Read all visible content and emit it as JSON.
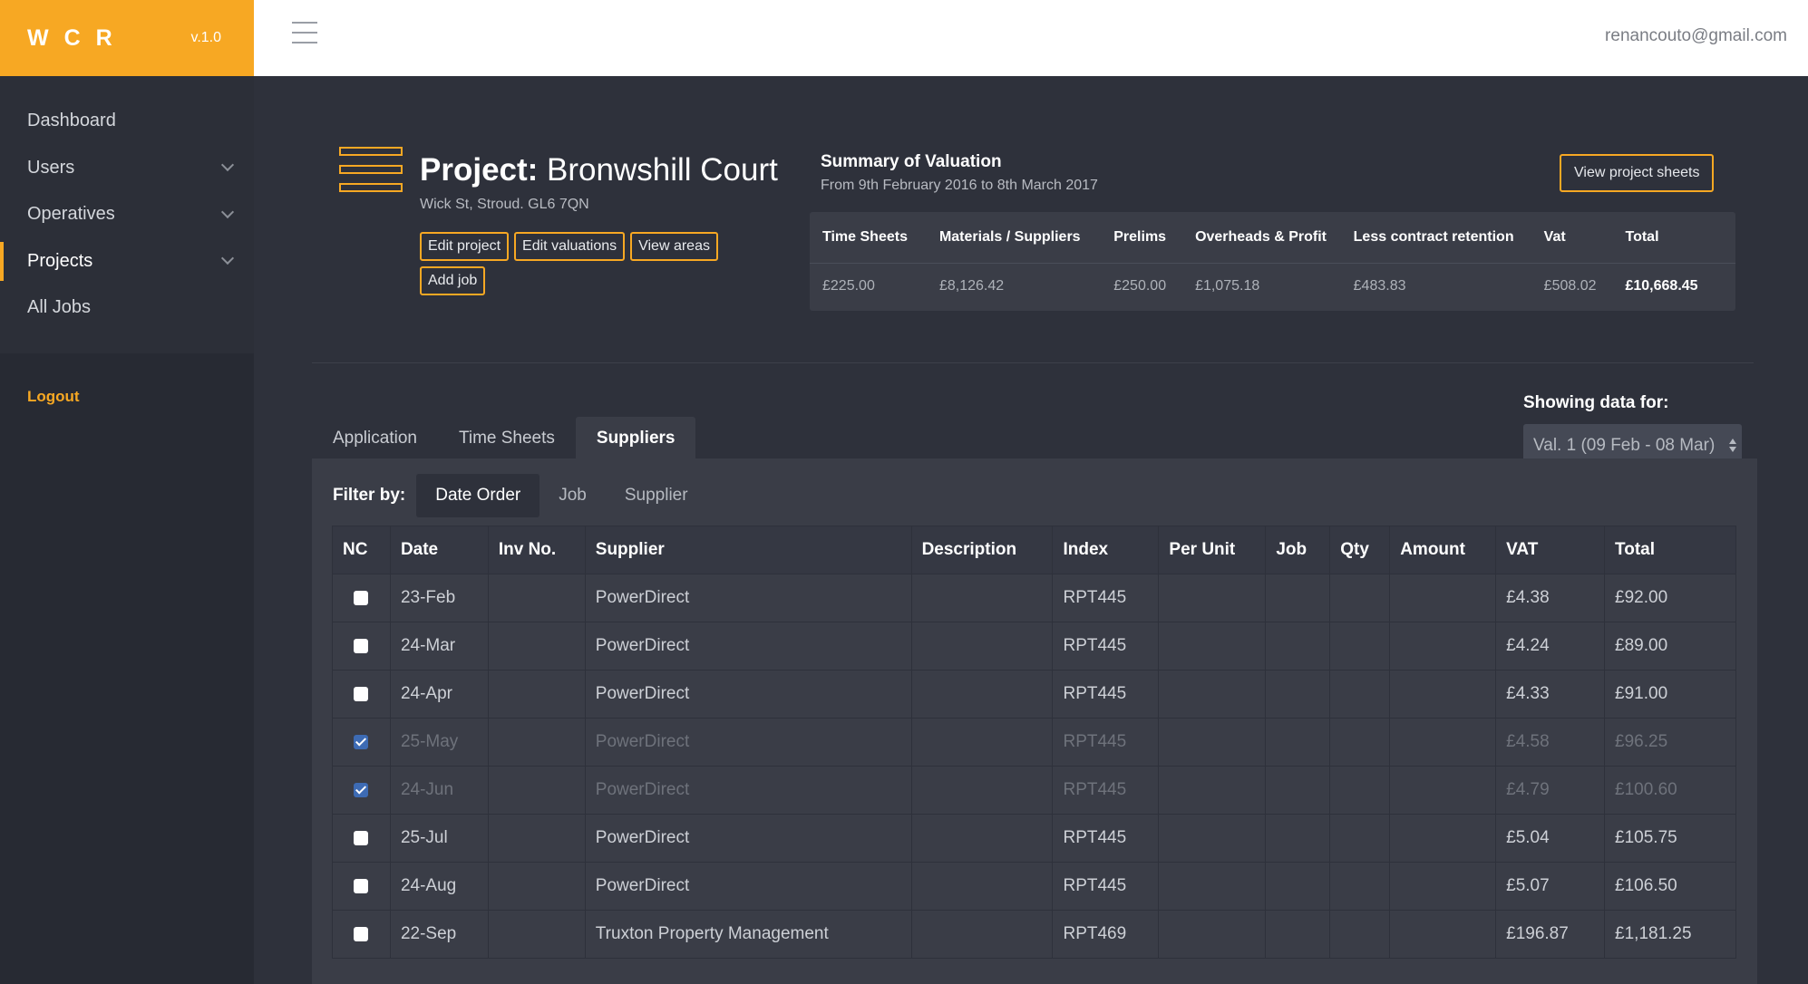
{
  "brand": {
    "name": "WCR",
    "version": "v.1.0"
  },
  "header": {
    "user_email": "renancouto@gmail.com"
  },
  "sidebar": {
    "items": [
      {
        "label": "Dashboard"
      },
      {
        "label": "Users"
      },
      {
        "label": "Operatives"
      },
      {
        "label": "Projects"
      },
      {
        "label": "All Jobs"
      }
    ],
    "logout_label": "Logout"
  },
  "project": {
    "title_prefix": "Project:",
    "name": "Bronwshill Court",
    "address": "Wick St, Stroud. GL6 7QN",
    "actions": {
      "edit_project": "Edit project",
      "edit_valuations": "Edit valuations",
      "view_areas": "View areas",
      "add_job": "Add job"
    },
    "view_sheets_label": "View project sheets"
  },
  "summary": {
    "title": "Summary of Valuation",
    "subtitle": "From 9th February 2016 to 8th March 2017",
    "headers": [
      "Time Sheets",
      "Materials / Suppliers",
      "Prelims",
      "Overheads & Profit",
      "Less contract retention",
      "Vat",
      "Total"
    ],
    "values": [
      "£225.00",
      "£8,126.42",
      "£250.00",
      "£1,075.18",
      "£483.83",
      "£508.02",
      "£10,668.45"
    ]
  },
  "showing": {
    "label": "Showing data for:",
    "selected": "Val. 1 (09 Feb - 08 Mar)"
  },
  "tabs": [
    {
      "label": "Application"
    },
    {
      "label": "Time Sheets"
    },
    {
      "label": "Suppliers"
    }
  ],
  "filter": {
    "label": "Filter by:",
    "options": [
      {
        "label": "Date Order"
      },
      {
        "label": "Job"
      },
      {
        "label": "Supplier"
      }
    ]
  },
  "table": {
    "headers": [
      "NC",
      "Date",
      "Inv No.",
      "Supplier",
      "Description",
      "Index",
      "Per Unit",
      "Job",
      "Qty",
      "Amount",
      "VAT",
      "Total"
    ],
    "rows": [
      {
        "nc": false,
        "date": "23-Feb",
        "inv": "",
        "supplier": "PowerDirect",
        "description": "",
        "index": "RPT445",
        "per_unit": "",
        "job": "",
        "qty": "",
        "amount": "",
        "vat": "£4.38",
        "total": "£92.00"
      },
      {
        "nc": false,
        "date": "24-Mar",
        "inv": "",
        "supplier": "PowerDirect",
        "description": "",
        "index": "RPT445",
        "per_unit": "",
        "job": "",
        "qty": "",
        "amount": "",
        "vat": "£4.24",
        "total": "£89.00"
      },
      {
        "nc": false,
        "date": "24-Apr",
        "inv": "",
        "supplier": "PowerDirect",
        "description": "",
        "index": "RPT445",
        "per_unit": "",
        "job": "",
        "qty": "",
        "amount": "",
        "vat": "£4.33",
        "total": "£91.00"
      },
      {
        "nc": true,
        "date": "25-May",
        "inv": "",
        "supplier": "PowerDirect",
        "description": "",
        "index": "RPT445",
        "per_unit": "",
        "job": "",
        "qty": "",
        "amount": "",
        "vat": "£4.58",
        "total": "£96.25"
      },
      {
        "nc": true,
        "date": "24-Jun",
        "inv": "",
        "supplier": "PowerDirect",
        "description": "",
        "index": "RPT445",
        "per_unit": "",
        "job": "",
        "qty": "",
        "amount": "",
        "vat": "£4.79",
        "total": "£100.60"
      },
      {
        "nc": false,
        "date": "25-Jul",
        "inv": "",
        "supplier": "PowerDirect",
        "description": "",
        "index": "RPT445",
        "per_unit": "",
        "job": "",
        "qty": "",
        "amount": "",
        "vat": "£5.04",
        "total": "£105.75"
      },
      {
        "nc": false,
        "date": "24-Aug",
        "inv": "",
        "supplier": "PowerDirect",
        "description": "",
        "index": "RPT445",
        "per_unit": "",
        "job": "",
        "qty": "",
        "amount": "",
        "vat": "£5.07",
        "total": "£106.50"
      },
      {
        "nc": false,
        "date": "22-Sep",
        "inv": "",
        "supplier": "Truxton Property Management",
        "description": "",
        "index": "RPT469",
        "per_unit": "",
        "job": "",
        "qty": "",
        "amount": "",
        "vat": "£196.87",
        "total": "£1,181.25"
      }
    ]
  },
  "colors": {
    "accent": "#f7a823",
    "background": "#2e313b",
    "sidebar": "#272a33",
    "panel": "#3a3d47",
    "checkbox_checked": "#3d6bb4"
  },
  "icons": {
    "menu": "hamburger-icon",
    "project": "project-layers-icon",
    "expand": "chevron-down-icon",
    "select": "sort-arrows-icon"
  }
}
